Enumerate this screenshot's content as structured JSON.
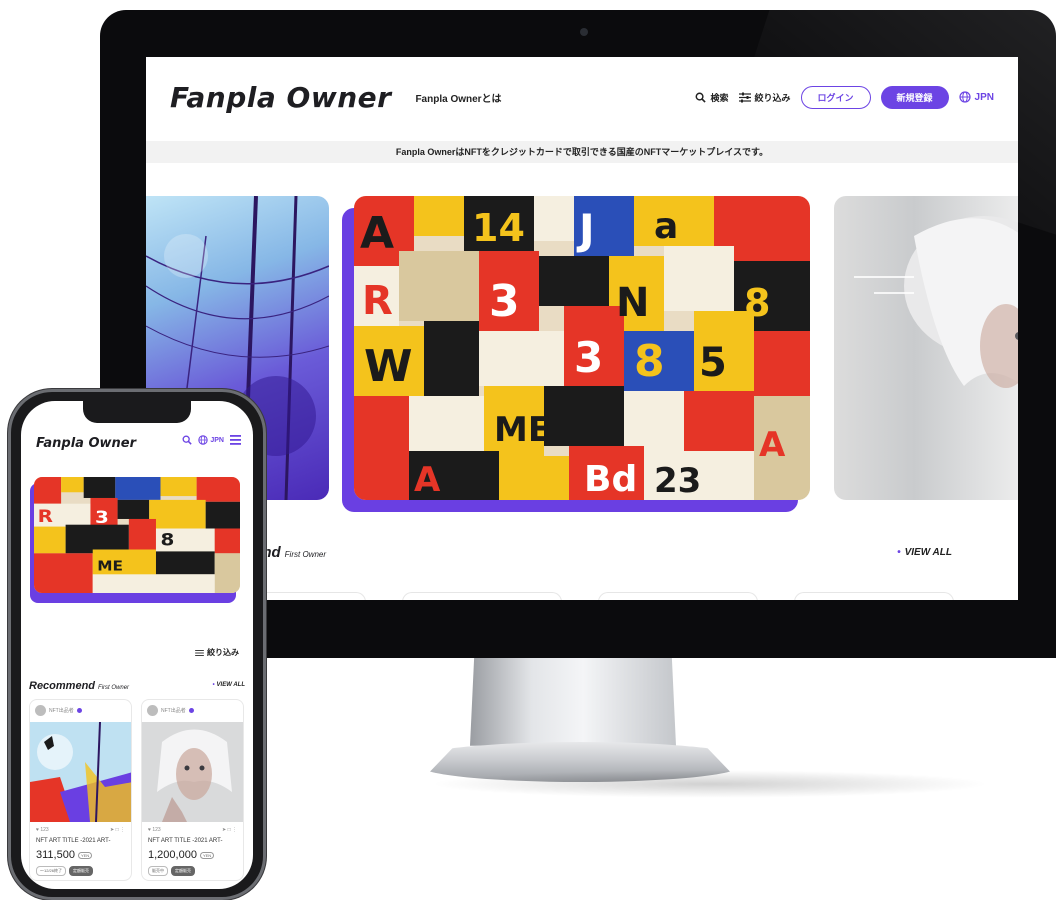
{
  "desktop": {
    "logo": "Fanpla Owner",
    "about_link": "Fanpla Ownerとは",
    "search_label": "検索",
    "filter_label": "絞り込み",
    "login_label": "ログイン",
    "signup_label": "新規登録",
    "language": "JPN",
    "banner_text": "Fanpla OwnerはNFTをクレジットカードで取引できる国産のNFTマーケットプレイスです。",
    "section_title": "end",
    "section_subtitle": "First Owner",
    "view_all": "VIEW ALL",
    "colors": {
      "accent": "#6c44e4",
      "text": "#1e1e22"
    }
  },
  "mobile": {
    "logo": "Fanpla Owner",
    "language": "JPN",
    "filter_label": "絞り込み",
    "section_title": "Recommend",
    "section_subtitle": "First Owner",
    "view_all": "VIEW ALL",
    "cards": [
      {
        "owner": "NFT出品者",
        "likes": "123",
        "title": "NFT ART TITLE -2021 ART-",
        "price": "311,500",
        "currency": "YEN",
        "tags": [
          "〜12/26終了",
          "定額販売"
        ]
      },
      {
        "owner": "NFT出品者",
        "likes": "123",
        "title": "NFT ART TITLE -2021 ART-",
        "price": "1,200,000",
        "currency": "YEN",
        "tags": [
          "販売中",
          "定額販売"
        ]
      }
    ]
  },
  "icons": [
    "search-icon",
    "filter-icon",
    "globe-icon",
    "menu-icon",
    "heart-icon",
    "share-icon",
    "more-icon",
    "verified-icon"
  ]
}
